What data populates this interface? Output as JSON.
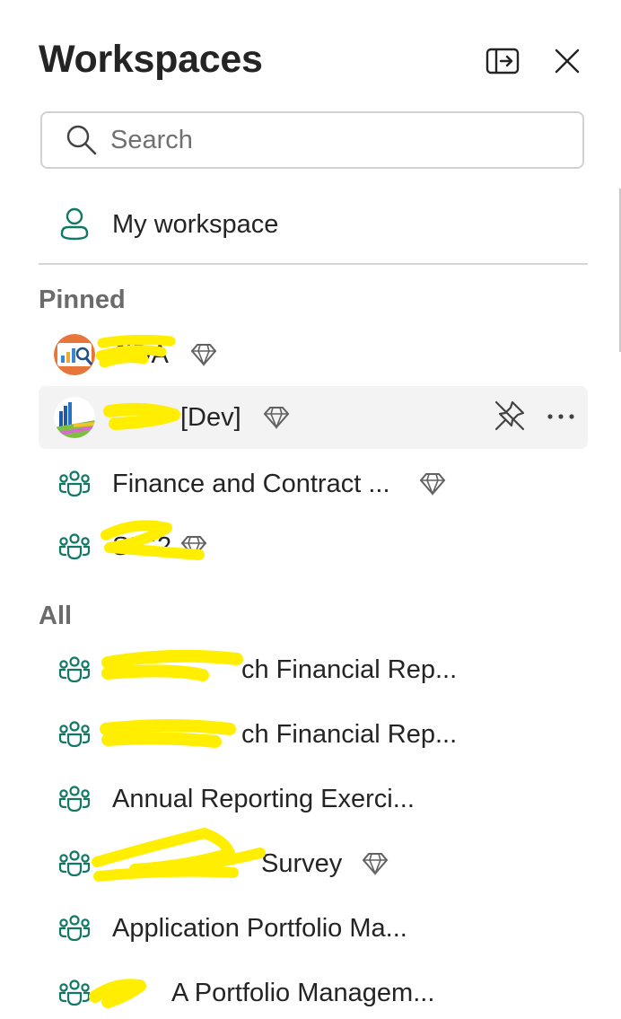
{
  "header": {
    "title": "Workspaces",
    "icons": {
      "dock": "dock-panel-icon",
      "close": "close-icon"
    }
  },
  "search": {
    "placeholder": "Search",
    "value": "",
    "icon": "search-icon"
  },
  "my_workspace": {
    "label": "My workspace",
    "icon": "person-icon"
  },
  "pinned": {
    "heading": "Pinned",
    "items": [
      {
        "label": "JIDA",
        "icon": "workspace-image-avatar",
        "premium": true
      },
      {
        "label": "[Dev]",
        "icon": "workspace-image-avatar",
        "premium": true,
        "selected": true
      },
      {
        "label": "Finance and Contract ...",
        "icon": "people-group-icon",
        "premium": true
      },
      {
        "label": "SIG2",
        "icon": "people-group-icon",
        "premium": true
      }
    ]
  },
  "all": {
    "heading": "All",
    "items": [
      {
        "label": "ch Financial Rep...",
        "icon": "people-group-icon",
        "premium": false
      },
      {
        "label": "ch Financial Rep...",
        "icon": "people-group-icon",
        "premium": false
      },
      {
        "label": "Annual Reporting Exerci...",
        "icon": "people-group-icon",
        "premium": false
      },
      {
        "label": "Survey",
        "icon": "people-group-icon",
        "premium": true
      },
      {
        "label": "Application Portfolio Ma...",
        "icon": "people-group-icon",
        "premium": false
      },
      {
        "label": "A Portfolio Managem...",
        "icon": "people-group-icon",
        "premium": false
      }
    ]
  },
  "colors": {
    "accent_teal": "#117865",
    "redaction_yellow": "#ffee00",
    "selected_row_bg": "#f3f3f3",
    "section_heading": "#6b6b6b"
  }
}
